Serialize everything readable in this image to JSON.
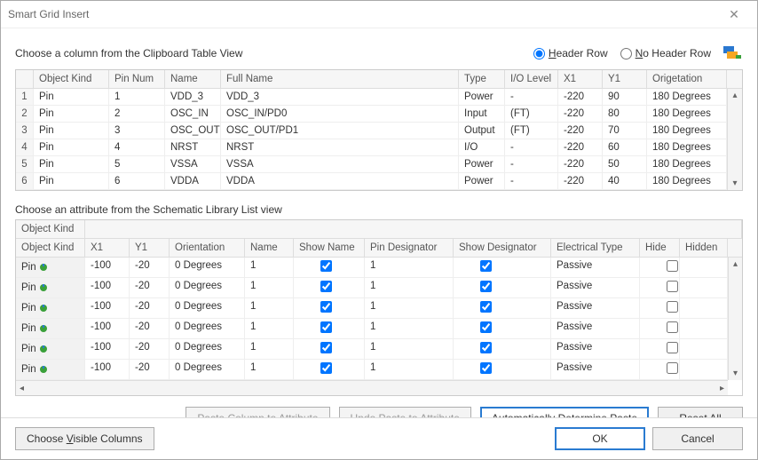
{
  "window": {
    "title": "Smart Grid Insert"
  },
  "section1": {
    "label": "Choose a column from the Clipboard Table View",
    "header_row_label_pre": "H",
    "header_row_label_rest": "eader Row",
    "no_header_row_label_pre": "N",
    "no_header_row_label_rest": "o Header Row",
    "header_row_selected": true
  },
  "table1": {
    "headers": [
      "",
      "Object Kind",
      "Pin Num",
      "Name",
      "Full Name",
      "Type",
      "I/O Level",
      "X1",
      "Y1",
      "Origetation"
    ],
    "rows": [
      {
        "n": "1",
        "kind": "Pin",
        "pin": "1",
        "name": "VDD_3",
        "full": "VDD_3",
        "type": "Power",
        "io": "-",
        "x1": "-220",
        "y1": "90",
        "or": "180 Degrees"
      },
      {
        "n": "2",
        "kind": "Pin",
        "pin": "2",
        "name": "OSC_IN",
        "full": "OSC_IN/PD0",
        "type": "Input",
        "io": "(FT)",
        "x1": "-220",
        "y1": "80",
        "or": "180 Degrees"
      },
      {
        "n": "3",
        "kind": "Pin",
        "pin": "3",
        "name": "OSC_OUT",
        "full": "OSC_OUT/PD1",
        "type": "Output",
        "io": "(FT)",
        "x1": "-220",
        "y1": "70",
        "or": "180 Degrees"
      },
      {
        "n": "4",
        "kind": "Pin",
        "pin": "4",
        "name": "NRST",
        "full": "NRST",
        "type": "I/O",
        "io": "-",
        "x1": "-220",
        "y1": "60",
        "or": "180 Degrees"
      },
      {
        "n": "5",
        "kind": "Pin",
        "pin": "5",
        "name": "VSSA",
        "full": "VSSA",
        "type": "Power",
        "io": "-",
        "x1": "-220",
        "y1": "50",
        "or": "180 Degrees"
      },
      {
        "n": "6",
        "kind": "Pin",
        "pin": "6",
        "name": "VDDA",
        "full": "VDDA",
        "type": "Power",
        "io": "-",
        "x1": "-220",
        "y1": "40",
        "or": "180 Degrees"
      }
    ]
  },
  "section2": {
    "label": "Choose an attribute from the Schematic Library List view"
  },
  "table2": {
    "filter_label": "Object Kind",
    "headers": [
      "Object Kind",
      "X1",
      "Y1",
      "Orientation",
      "Name",
      "Show Name",
      "Pin Designator",
      "Show Designator",
      "Electrical Type",
      "Hide",
      "Hidden"
    ],
    "rows": [
      {
        "kind": "Pin",
        "x1": "-100",
        "y1": "-20",
        "or": "0 Degrees",
        "name": "1",
        "sn": true,
        "pd": "1",
        "sd": true,
        "et": "Passive",
        "hide": false
      },
      {
        "kind": "Pin",
        "x1": "-100",
        "y1": "-20",
        "or": "0 Degrees",
        "name": "1",
        "sn": true,
        "pd": "1",
        "sd": true,
        "et": "Passive",
        "hide": false
      },
      {
        "kind": "Pin",
        "x1": "-100",
        "y1": "-20",
        "or": "0 Degrees",
        "name": "1",
        "sn": true,
        "pd": "1",
        "sd": true,
        "et": "Passive",
        "hide": false
      },
      {
        "kind": "Pin",
        "x1": "-100",
        "y1": "-20",
        "or": "0 Degrees",
        "name": "1",
        "sn": true,
        "pd": "1",
        "sd": true,
        "et": "Passive",
        "hide": false
      },
      {
        "kind": "Pin",
        "x1": "-100",
        "y1": "-20",
        "or": "0 Degrees",
        "name": "1",
        "sn": true,
        "pd": "1",
        "sd": true,
        "et": "Passive",
        "hide": false
      },
      {
        "kind": "Pin",
        "x1": "-100",
        "y1": "-20",
        "or": "0 Degrees",
        "name": "1",
        "sn": true,
        "pd": "1",
        "sd": true,
        "et": "Passive",
        "hide": false
      }
    ]
  },
  "buttons": {
    "paste_column": "Paste Column to Attribute",
    "undo_paste": "Undo Paste to Attribute",
    "auto_paste": "Automatically Determine Paste",
    "reset_all_pre": "R",
    "reset_all_mid": "e",
    "reset_all_rest": "set All",
    "choose_visible_pre": "Choose ",
    "choose_visible_u": "V",
    "choose_visible_rest": "isible Columns",
    "ok": "OK",
    "cancel": "Cancel"
  }
}
